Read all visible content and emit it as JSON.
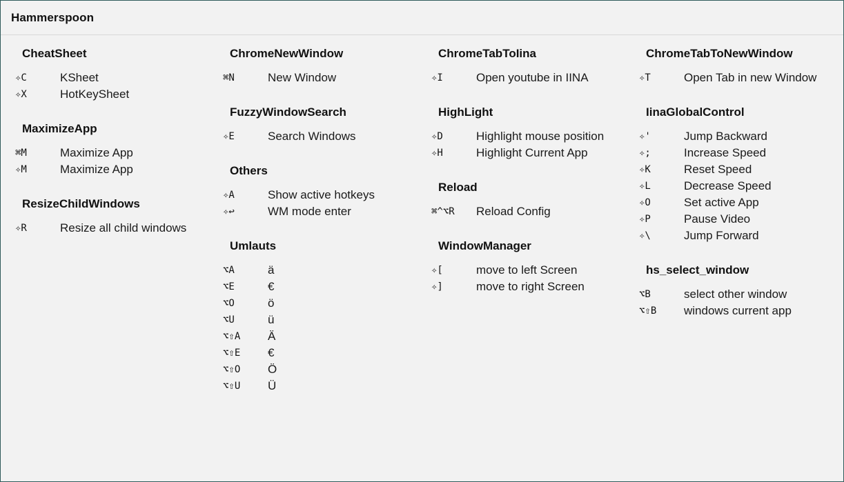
{
  "window": {
    "title": "Hammerspoon"
  },
  "columns": [
    {
      "sections": [
        {
          "title": "CheatSheet",
          "items": [
            {
              "key": "✧C",
              "desc": "KSheet"
            },
            {
              "key": "✧X",
              "desc": "HotKeySheet"
            }
          ]
        },
        {
          "title": "MaximizeApp",
          "items": [
            {
              "key": "⌘M",
              "desc": "Maximize App"
            },
            {
              "key": "✧M",
              "desc": "Maximize App"
            }
          ]
        },
        {
          "title": "ResizeChildWindows",
          "items": [
            {
              "key": "✧R",
              "desc": "Resize all child windows"
            }
          ]
        }
      ]
    },
    {
      "sections": [
        {
          "title": "ChromeNewWindow",
          "items": [
            {
              "key": "⌘N",
              "desc": "New Window"
            }
          ]
        },
        {
          "title": "FuzzyWindowSearch",
          "items": [
            {
              "key": "✧E",
              "desc": "Search Windows"
            }
          ]
        },
        {
          "title": "Others",
          "items": [
            {
              "key": "✧A",
              "desc": "Show active hotkeys"
            },
            {
              "key": "✧↩",
              "desc": "WM mode enter"
            }
          ]
        },
        {
          "title": "Umlauts",
          "items": [
            {
              "key": "⌥A",
              "desc": "ä"
            },
            {
              "key": "⌥E",
              "desc": "€"
            },
            {
              "key": "⌥O",
              "desc": "ö"
            },
            {
              "key": "⌥U",
              "desc": "ü"
            },
            {
              "key": "⌥⇧A",
              "desc": "Ä"
            },
            {
              "key": "⌥⇧E",
              "desc": "€"
            },
            {
              "key": "⌥⇧O",
              "desc": "Ö"
            },
            {
              "key": "⌥⇧U",
              "desc": "Ü"
            }
          ]
        }
      ]
    },
    {
      "sections": [
        {
          "title": "ChromeTabToIina",
          "items": [
            {
              "key": "✧I",
              "desc": "Open youtube in IINA"
            }
          ]
        },
        {
          "title": "HighLight",
          "items": [
            {
              "key": "✧D",
              "desc": "Highlight mouse position"
            },
            {
              "key": "✧H",
              "desc": "Highlight Current App"
            }
          ]
        },
        {
          "title": "Reload",
          "items": [
            {
              "key": "⌘^⌥R",
              "desc": "Reload Config"
            }
          ]
        },
        {
          "title": "WindowManager",
          "items": [
            {
              "key": "✧[",
              "desc": "move to left Screen"
            },
            {
              "key": "✧]",
              "desc": "move to right Screen"
            }
          ]
        }
      ]
    },
    {
      "sections": [
        {
          "title": "ChromeTabToNewWindow",
          "items": [
            {
              "key": "✧T",
              "desc": "Open Tab in new Window"
            }
          ]
        },
        {
          "title": "IinaGlobalControl",
          "items": [
            {
              "key": "✧'",
              "desc": "Jump Backward"
            },
            {
              "key": "✧;",
              "desc": "Increase Speed"
            },
            {
              "key": "✧K",
              "desc": "Reset Speed"
            },
            {
              "key": "✧L",
              "desc": "Decrease Speed"
            },
            {
              "key": "✧O",
              "desc": "Set active App"
            },
            {
              "key": "✧P",
              "desc": "Pause Video"
            },
            {
              "key": "✧\\",
              "desc": "Jump Forward"
            }
          ]
        },
        {
          "title": "hs_select_window",
          "items": [
            {
              "key": "⌥B",
              "desc": "select other window"
            },
            {
              "key": "⌥⇧B",
              "desc": "windows current app"
            }
          ]
        }
      ]
    }
  ]
}
